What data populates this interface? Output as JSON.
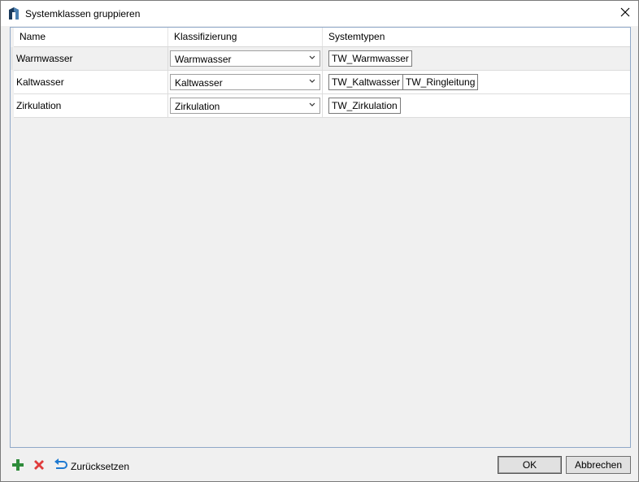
{
  "window": {
    "title": "Systemklassen gruppieren"
  },
  "grid": {
    "columns": [
      "Name",
      "Klassifizierung",
      "Systemtypen"
    ],
    "rows": [
      {
        "name": "Warmwasser",
        "classification": "Warmwasser",
        "systemtypes": [
          "TW_Warmwasser"
        ]
      },
      {
        "name": "Kaltwasser",
        "classification": "Kaltwasser",
        "systemtypes": [
          "TW_Kaltwasser",
          "TW_Ringleitung"
        ]
      },
      {
        "name": "Zirkulation",
        "classification": "Zirkulation",
        "systemtypes": [
          "TW_Zirkulation"
        ]
      }
    ]
  },
  "footer": {
    "reset_label": "Zurücksetzen",
    "ok_label": "OK",
    "cancel_label": "Abbrechen"
  },
  "icons": {
    "app": "app-logo-icon",
    "close": "close-icon",
    "add": "plus-icon",
    "delete": "delete-x-icon",
    "reset": "undo-arrow-icon",
    "dropdown": "chevron-down-icon"
  },
  "colors": {
    "add": "#2e8b3a",
    "delete": "#e03c3c",
    "reset": "#1f7ad1",
    "grid_border": "#8fa8c8"
  }
}
